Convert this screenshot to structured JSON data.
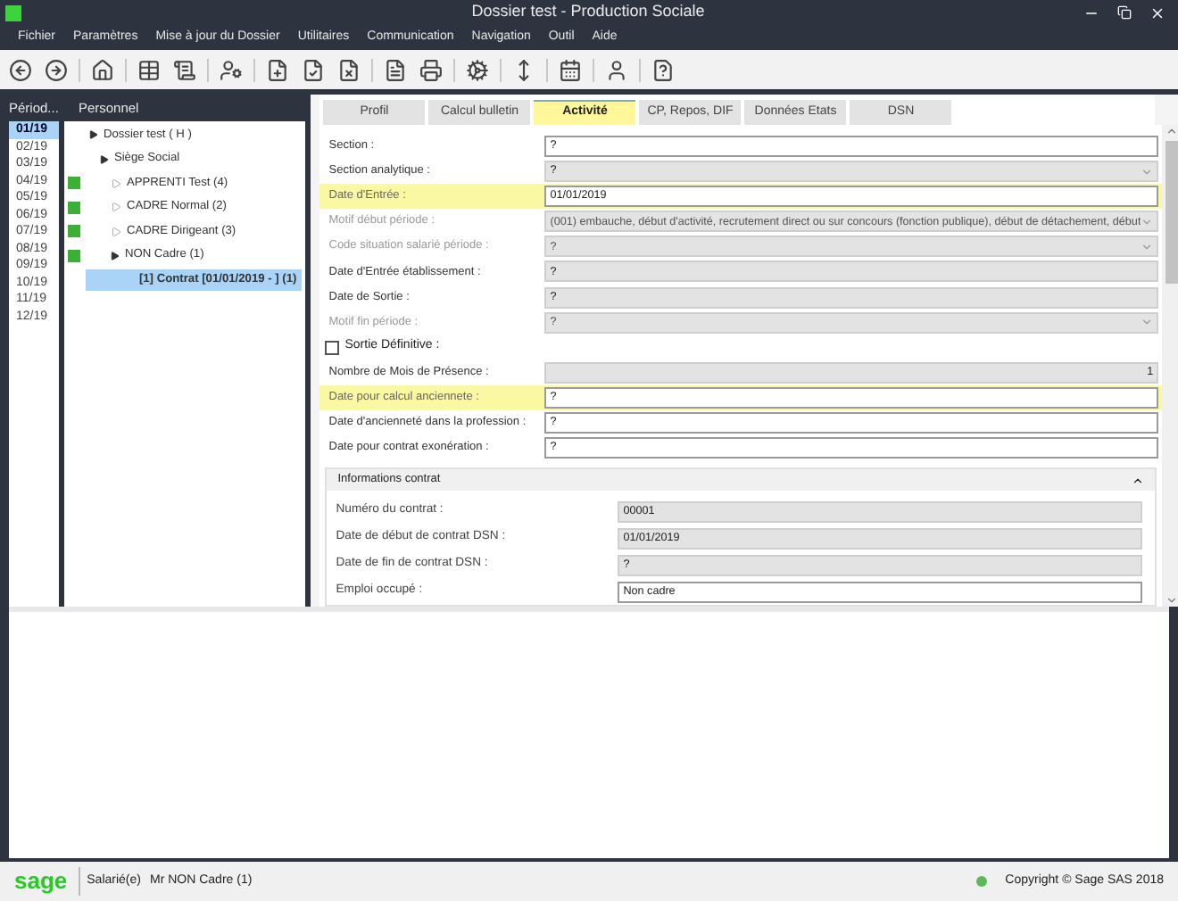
{
  "window": {
    "title": "Dossier test - Production Sociale"
  },
  "menu": [
    "Fichier",
    "Paramètres",
    "Mise à jour du Dossier",
    "Utilitaires",
    "Communication",
    "Navigation",
    "Outil",
    "Aide"
  ],
  "periods": {
    "header": "Périod...",
    "items": [
      {
        "label": "01/19",
        "selected": true
      },
      {
        "label": "02/19",
        "selected": false
      },
      {
        "label": "03/19",
        "selected": false
      },
      {
        "label": "04/19",
        "selected": false
      },
      {
        "label": "05/19",
        "selected": false
      },
      {
        "label": "06/19",
        "selected": false
      },
      {
        "label": "07/19",
        "selected": false
      },
      {
        "label": "08/19",
        "selected": false
      },
      {
        "label": "09/19",
        "selected": false
      },
      {
        "label": "10/19",
        "selected": false
      },
      {
        "label": "11/19",
        "selected": false
      },
      {
        "label": "12/19",
        "selected": false
      }
    ]
  },
  "tree": {
    "header": "Personnel",
    "items": [
      {
        "label": "Dossier test ( H )",
        "expanded": true,
        "selected": false,
        "children": [
          {
            "label": "Siège Social",
            "expanded": true,
            "selected": false,
            "children": [
              {
                "label": "APPRENTI Test (4)",
                "expanded": false,
                "marked": true,
                "selected": false
              },
              {
                "label": "CADRE Normal (2)",
                "expanded": false,
                "marked": true,
                "selected": false
              },
              {
                "label": "CADRE Dirigeant (3)",
                "expanded": false,
                "marked": true,
                "selected": false
              },
              {
                "label": "NON Cadre (1)",
                "expanded": true,
                "marked": true,
                "selected": false,
                "children": [
                  {
                    "label": "[1] Contrat [01/01/2019 - ] (1)",
                    "selected": true
                  }
                ]
              }
            ]
          }
        ]
      }
    ]
  },
  "tabs": [
    {
      "label": "Profil",
      "selected": false
    },
    {
      "label": "Calcul bulletin",
      "selected": false
    },
    {
      "label": "Activité",
      "selected": true
    },
    {
      "label": "CP, Repos, DIF",
      "selected": false
    },
    {
      "label": "Données Etats",
      "selected": false
    },
    {
      "label": "DSN",
      "selected": false
    }
  ],
  "fields": [
    {
      "kind": "text",
      "label": "Section :",
      "value": "?",
      "editable": true,
      "disabled": false,
      "highlighted": false
    },
    {
      "kind": "combo",
      "label": "Section analytique :",
      "value": "?",
      "editable": false,
      "disabled": false,
      "highlighted": false
    },
    {
      "kind": "text",
      "label": "Date d'Entrée :",
      "value": "01/01/2019",
      "editable": true,
      "disabled": false,
      "highlighted": true
    },
    {
      "kind": "combo",
      "label": "Motif début période :",
      "value": "(001) embauche, début d'activité, recrutement direct ou sur concours (fonction publique), début de détachement, début",
      "editable": false,
      "disabled": true,
      "highlighted": false
    },
    {
      "kind": "combo",
      "label": "Code situation salarié période :",
      "value": "?",
      "editable": false,
      "disabled": true,
      "highlighted": false
    },
    {
      "kind": "text",
      "label": "Date d'Entrée établissement :",
      "value": "?",
      "editable": false,
      "disabled": false,
      "highlighted": false
    },
    {
      "kind": "text",
      "label": "Date de Sortie :",
      "value": "?",
      "editable": false,
      "disabled": false,
      "highlighted": false
    },
    {
      "kind": "combo",
      "label": "Motif fin période :",
      "value": "?",
      "editable": false,
      "disabled": true,
      "highlighted": false
    },
    {
      "kind": "checkbox",
      "label": "Sortie Définitive :",
      "checked": false
    },
    {
      "kind": "number",
      "label": "Nombre de Mois de Présence :",
      "value": "1",
      "editable": false,
      "disabled": false,
      "highlighted": false
    },
    {
      "kind": "text",
      "label": "Date pour calcul anciennete :",
      "value": "?",
      "editable": true,
      "disabled": false,
      "highlighted": true
    },
    {
      "kind": "text",
      "label": "Date d'ancienneté dans la profession :",
      "value": "?",
      "editable": true,
      "disabled": false,
      "highlighted": false
    },
    {
      "kind": "text",
      "label": "Date pour contrat exonération :",
      "value": "?",
      "editable": true,
      "disabled": false,
      "highlighted": false
    }
  ],
  "contract": {
    "title": "Informations contrat",
    "expanded": true,
    "fields": [
      {
        "label": "Numéro du contrat :",
        "value": "00001",
        "editable": false
      },
      {
        "label": "Date de début de contrat DSN :",
        "value": "01/01/2019",
        "editable": false
      },
      {
        "label": "Date de fin de contrat DSN :",
        "value": "?",
        "editable": false
      },
      {
        "label": "Emploi occupé :",
        "value": "Non cadre",
        "editable": true
      }
    ]
  },
  "status_bar": {
    "logo": "sage",
    "label": "Salarié(e)",
    "value": "Mr NON Cadre (1)",
    "copyright": "Copyright © Sage SAS 2018"
  }
}
